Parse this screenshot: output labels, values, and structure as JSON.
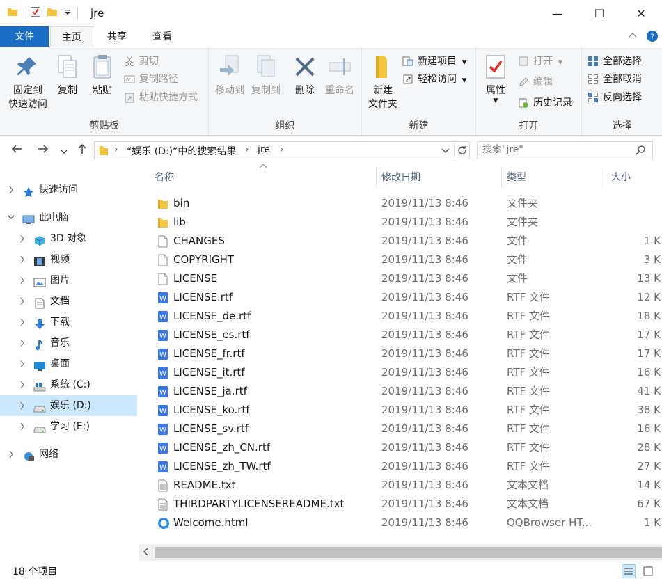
{
  "window": {
    "title": "jre",
    "minimize_glyph": "—",
    "maximize_glyph": "☐",
    "close_glyph": "✕"
  },
  "ribbon_tabs": [
    "文件",
    "主页",
    "共享",
    "查看"
  ],
  "ribbon": {
    "clipboard": {
      "label": "剪贴板",
      "pin": "固定到\n快速访问",
      "pin_line1": "固定到",
      "pin_line2": "快速访问",
      "copy": "复制",
      "paste": "粘贴",
      "cut": "剪切",
      "copy_path": "复制路径",
      "paste_shortcut": "粘贴快捷方式"
    },
    "organize": {
      "label": "组织",
      "move_to": "移动到",
      "copy_to": "复制到",
      "delete": "删除",
      "rename": "重命名"
    },
    "new": {
      "label": "新建",
      "new_folder_line1": "新建",
      "new_folder_line2": "文件夹",
      "new_item": "新建项目",
      "easy_access": "轻松访问"
    },
    "open": {
      "label": "打开",
      "properties": "属性",
      "open": "打开",
      "edit": "编辑",
      "history": "历史记录"
    },
    "select": {
      "label": "选择",
      "select_all": "全部选择",
      "select_none": "全部取消",
      "invert": "反向选择"
    }
  },
  "address": {
    "segment1": "“娱乐 (D:)”中的搜索结果",
    "segment2": "jre",
    "search_placeholder": "搜索\"jre\""
  },
  "nav_tree": [
    {
      "label": "快速访问",
      "icon": "star-icon",
      "level": 0,
      "expander": "›",
      "selected": false
    },
    {
      "label": "此电脑",
      "icon": "computer-icon",
      "level": 0,
      "expander": "⌄",
      "selected": false
    },
    {
      "label": "3D 对象",
      "icon": "cube-icon",
      "level": 1,
      "expander": "›",
      "selected": false
    },
    {
      "label": "视频",
      "icon": "film-icon",
      "level": 1,
      "expander": "›",
      "selected": false
    },
    {
      "label": "图片",
      "icon": "picture-icon",
      "level": 1,
      "expander": "›",
      "selected": false
    },
    {
      "label": "文档",
      "icon": "document-icon",
      "level": 1,
      "expander": "›",
      "selected": false
    },
    {
      "label": "下载",
      "icon": "download-icon",
      "level": 1,
      "expander": "›",
      "selected": false
    },
    {
      "label": "音乐",
      "icon": "music-icon",
      "level": 1,
      "expander": "›",
      "selected": false
    },
    {
      "label": "桌面",
      "icon": "desktop-icon",
      "level": 1,
      "expander": "›",
      "selected": false
    },
    {
      "label": "系统 (C:)",
      "icon": "windows-drive-icon",
      "level": 1,
      "expander": "›",
      "selected": false
    },
    {
      "label": "娱乐 (D:)",
      "icon": "drive-icon",
      "level": 1,
      "expander": "›",
      "selected": true
    },
    {
      "label": "学习 (E:)",
      "icon": "drive-icon",
      "level": 1,
      "expander": "›",
      "selected": false
    },
    {
      "label": "网络",
      "icon": "network-icon",
      "level": 0,
      "expander": "›",
      "selected": false
    }
  ],
  "columns": {
    "name": "名称",
    "date": "修改日期",
    "type": "类型",
    "size": "大小"
  },
  "files": [
    {
      "name": "bin",
      "date": "2019/11/13 8:46",
      "type": "文件夹",
      "size": "",
      "icon": "folder-icon"
    },
    {
      "name": "lib",
      "date": "2019/11/13 8:46",
      "type": "文件夹",
      "size": "",
      "icon": "folder-icon"
    },
    {
      "name": "CHANGES",
      "date": "2019/11/13 8:46",
      "type": "文件",
      "size": "1 K",
      "icon": "file-icon"
    },
    {
      "name": "COPYRIGHT",
      "date": "2019/11/13 8:46",
      "type": "文件",
      "size": "3 K",
      "icon": "file-icon"
    },
    {
      "name": "LICENSE",
      "date": "2019/11/13 8:46",
      "type": "文件",
      "size": "13 K",
      "icon": "file-icon"
    },
    {
      "name": "LICENSE.rtf",
      "date": "2019/11/13 8:46",
      "type": "RTF 文件",
      "size": "12 K",
      "icon": "word-rtf-icon"
    },
    {
      "name": "LICENSE_de.rtf",
      "date": "2019/11/13 8:46",
      "type": "RTF 文件",
      "size": "18 K",
      "icon": "word-rtf-icon"
    },
    {
      "name": "LICENSE_es.rtf",
      "date": "2019/11/13 8:46",
      "type": "RTF 文件",
      "size": "17 K",
      "icon": "word-rtf-icon"
    },
    {
      "name": "LICENSE_fr.rtf",
      "date": "2019/11/13 8:46",
      "type": "RTF 文件",
      "size": "17 K",
      "icon": "word-rtf-icon"
    },
    {
      "name": "LICENSE_it.rtf",
      "date": "2019/11/13 8:46",
      "type": "RTF 文件",
      "size": "16 K",
      "icon": "word-rtf-icon"
    },
    {
      "name": "LICENSE_ja.rtf",
      "date": "2019/11/13 8:46",
      "type": "RTF 文件",
      "size": "41 K",
      "icon": "word-rtf-icon"
    },
    {
      "name": "LICENSE_ko.rtf",
      "date": "2019/11/13 8:46",
      "type": "RTF 文件",
      "size": "38 K",
      "icon": "word-rtf-icon"
    },
    {
      "name": "LICENSE_sv.rtf",
      "date": "2019/11/13 8:46",
      "type": "RTF 文件",
      "size": "16 K",
      "icon": "word-rtf-icon"
    },
    {
      "name": "LICENSE_zh_CN.rtf",
      "date": "2019/11/13 8:46",
      "type": "RTF 文件",
      "size": "28 K",
      "icon": "word-rtf-icon"
    },
    {
      "name": "LICENSE_zh_TW.rtf",
      "date": "2019/11/13 8:46",
      "type": "RTF 文件",
      "size": "27 K",
      "icon": "word-rtf-icon"
    },
    {
      "name": "README.txt",
      "date": "2019/11/13 8:46",
      "type": "文本文档",
      "size": "14 K",
      "icon": "text-file-icon"
    },
    {
      "name": "THIRDPARTYLICENSEREADME.txt",
      "date": "2019/11/13 8:46",
      "type": "文本文档",
      "size": "67 K",
      "icon": "text-file-icon"
    },
    {
      "name": "Welcome.html",
      "date": "2019/11/13 8:46",
      "type": "QQBrowser HT...",
      "size": "1 K",
      "icon": "qqbrowser-icon"
    }
  ],
  "status": {
    "item_count": "18 个项目"
  },
  "colors": {
    "accent": "#1a6fc4",
    "selection": "#cce8ff",
    "folder": "#f4c542",
    "rtf": "#3b78e7"
  }
}
